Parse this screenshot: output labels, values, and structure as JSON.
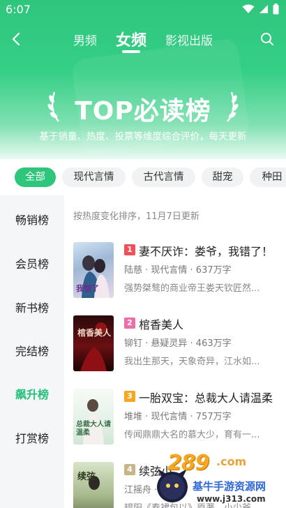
{
  "status_bar": {
    "time": "6:07"
  },
  "nav": {
    "tabs": [
      "男频",
      "女频",
      "影视出版"
    ],
    "active_tab": 1
  },
  "hero": {
    "title": "TOP必读榜",
    "subtitle": "基于销量、热度、投票等维度综合评价，每天更新"
  },
  "filters": {
    "chips": [
      "全部",
      "现代言情",
      "古代言情",
      "甜宠",
      "种田"
    ],
    "active": 0
  },
  "sidebar": {
    "items": [
      "畅销榜",
      "会员榜",
      "新书榜",
      "完结榜",
      "飙升榜",
      "打赏榜"
    ],
    "active": 4
  },
  "list": {
    "sort_note": "按热度变化排序，11月7日更新",
    "books": [
      {
        "rank": "1",
        "title": "妻不厌诈：娄爷，我错了！",
        "meta": "陆慈 · 现代言情 · 637万字",
        "desc": "强势桀骜的商业帝王娄天钦匠然...",
        "rank_color": "#f0505a",
        "cover_text": "我错了"
      },
      {
        "rank": "2",
        "title": "棺香美人",
        "meta": "铆钉 · 悬疑灵异 · 463万字",
        "desc": "我出生那天，天象奇异，江水如...",
        "rank_color": "#ee6fa8",
        "cover_text": "棺香美人"
      },
      {
        "rank": "3",
        "title": "一胎双宝：总裁大人请温柔",
        "meta": "堆堆 · 现代言情 · 757万字",
        "desc": "传闻鼎鼎大名的慕大少，育有一...",
        "rank_color": "#f5a623",
        "cover_text": "总裁大人请温柔"
      },
      {
        "rank": "4",
        "title": "续弦小",
        "meta": "江摇舟 · 古",
        "desc": "韫阳《春裙包以》原著，小少爷...",
        "rank_color": "#c9b48a",
        "cover_text": "续弦"
      }
    ]
  },
  "watermark": {
    "logo": "289",
    "com": ".com",
    "text": "基牛手游资源网",
    "url": "www.j313.com"
  },
  "colors": {
    "accent": "#2dc67b",
    "hero": "#35cf86"
  }
}
